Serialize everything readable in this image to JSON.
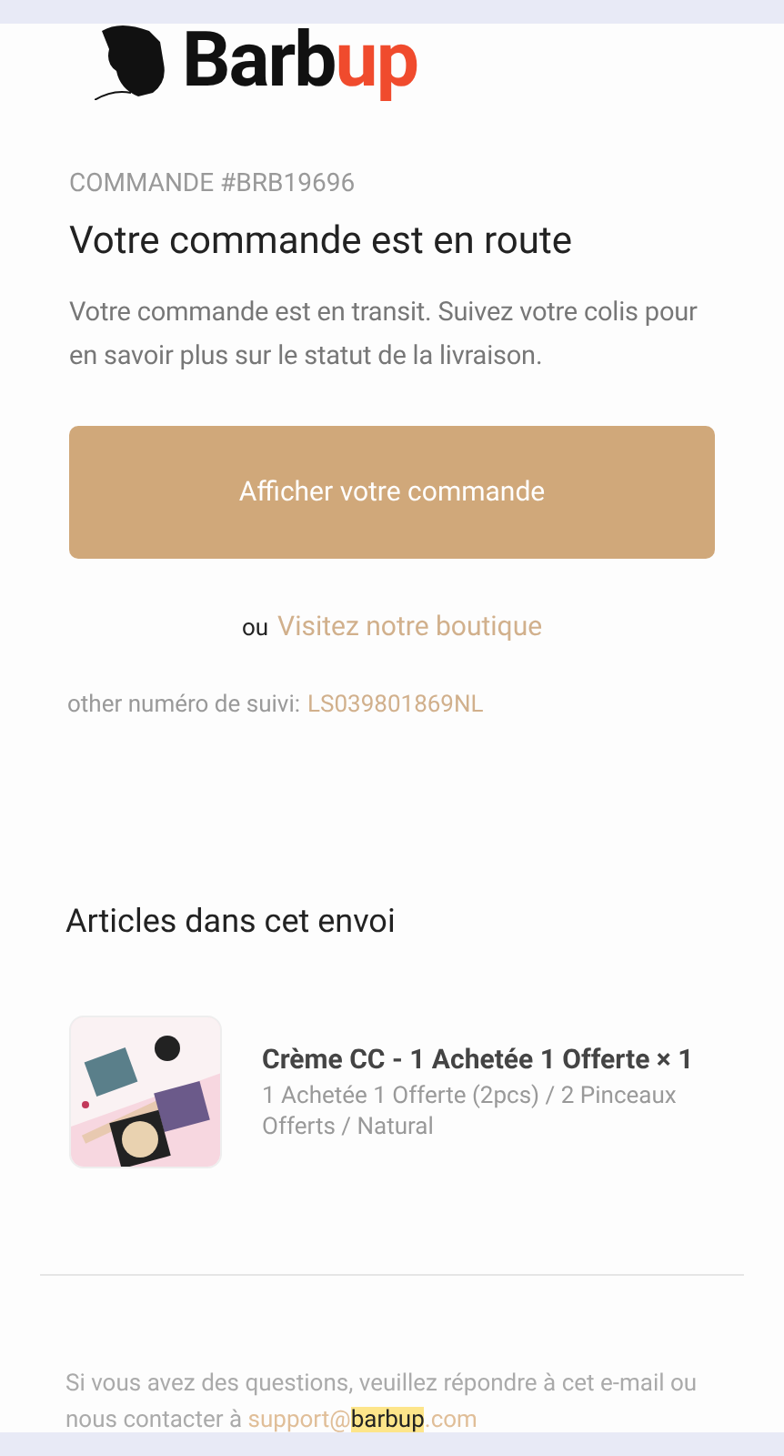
{
  "logo": {
    "dark": "Barb",
    "accent": "up"
  },
  "order_number": "COMMANDE #BRB19696",
  "title": "Votre commande est en route",
  "message": "Votre commande est en transit. Suivez votre colis pour en savoir plus sur le statut de la livraison.",
  "primary_button": "Afficher votre commande",
  "store_prefix": "ou",
  "store_link": "Visitez notre boutique",
  "tracking_label": "other numéro de suivi:",
  "tracking_number": "LS039801869NL",
  "items_heading": "Articles dans cet envoi",
  "items": [
    {
      "name": "Crème CC - 1 Achetée 1 Offerte × 1",
      "variant": "1 Achetée 1 Offerte (2pcs) / 2 Pinceaux Offerts / Natural"
    }
  ],
  "footer": {
    "text": "Si vous avez des questions, veuillez répondre à cet e-mail ou nous contacter à",
    "email_before": "support@",
    "email_highlight": "barbup",
    "email_after": ".com"
  }
}
